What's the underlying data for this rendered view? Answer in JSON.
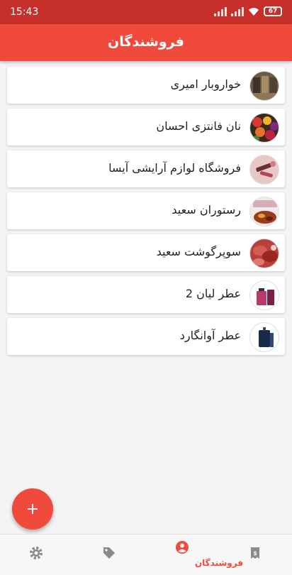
{
  "status_bar": {
    "time": "15:43",
    "battery": "67"
  },
  "app_bar": {
    "title": "فروشندگان"
  },
  "vendors": [
    {
      "name": "خواروبار امیری",
      "image": "grocery-store-photo"
    },
    {
      "name": "نان فانتزی احسان",
      "image": "bakery-photo"
    },
    {
      "name": "فروشگاه لوازم آرایشی آیسا",
      "image": "cosmetics-photo"
    },
    {
      "name": "رستوران سعید",
      "image": "restaurant-food-photo"
    },
    {
      "name": "سوپرگوشت سعید",
      "image": "meat-photo"
    },
    {
      "name": "عطر لیان 2",
      "image": "perfume-bottle-photo"
    },
    {
      "name": "عطر آوانگارد",
      "image": "perfume-bottle-dark-photo"
    }
  ],
  "fab": {
    "icon": "plus-icon"
  },
  "bottom_nav": {
    "items": [
      {
        "icon": "gear-icon",
        "label": ""
      },
      {
        "icon": "tag-icon",
        "label": ""
      },
      {
        "icon": "account-circle-icon",
        "label": "فروشندگان",
        "active": true
      },
      {
        "icon": "invoice-icon",
        "label": ""
      }
    ]
  },
  "colors": {
    "primary": "#ef4a3c",
    "status_bar": "#c62f2a",
    "background": "#f4f4f4"
  }
}
